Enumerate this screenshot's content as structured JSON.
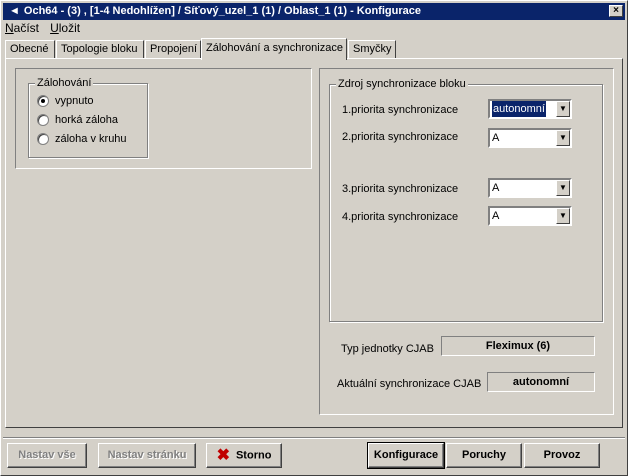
{
  "window": {
    "title": "Och64 - (3) , [1-4 Nedohlížen] / Síťový_uzel_1 (1) / Oblast_1 (1) - Konfigurace",
    "title_icon": "◄",
    "close_label": "×"
  },
  "menu": [
    "Načíst",
    "Uložit"
  ],
  "tabs": [
    "Obecné",
    "Topologie bloku",
    "Propojení",
    "Zálohování a synchronizace",
    "Smyčky"
  ],
  "backup": {
    "title": "Zálohování",
    "options": [
      "vypnuto",
      "horká záloha",
      "záloha v kruhu"
    ],
    "selected": "vypnuto"
  },
  "sync": {
    "title": "Zdroj synchronizace bloku",
    "priorities": [
      {
        "label": "1.priorita synchronizace",
        "value": "autonomní"
      },
      {
        "label": "2.priorita synchronizace",
        "value": "A"
      },
      {
        "label": "3.priorita synchronizace",
        "value": "A"
      },
      {
        "label": "4.priorita synchronizace",
        "value": "A"
      }
    ],
    "unit_type_label": "Typ jednotky CJAB",
    "unit_type_value": "Fleximux (6)",
    "current_sync_label": "Aktuální synchronizace CJAB",
    "current_sync_value": "autonomní"
  },
  "buttons": {
    "set_all": "Nastav vše",
    "set_page": "Nastav stránku",
    "cancel": "Storno",
    "config": "Konfigurace",
    "faults": "Poruchy",
    "operation": "Provoz"
  },
  "icons": {
    "combo_arrow": "▼",
    "cancel_icon": "✖"
  }
}
